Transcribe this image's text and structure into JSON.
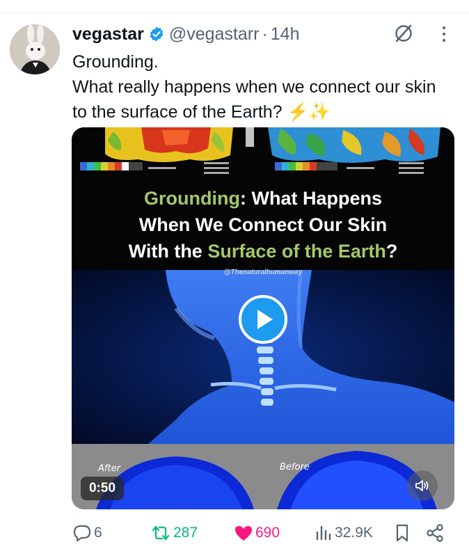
{
  "tweet": {
    "display_name": "vegastar",
    "handle": "@vegastarr",
    "separator": "·",
    "time": "14h",
    "text_line1": "Grounding.",
    "text_line2": "What really happens when we connect our skin to the surface of the Earth?",
    "emoji_bolt": "⚡",
    "emoji_sparkles": "✨"
  },
  "media": {
    "caption_p1_green": "Grounding",
    "caption_p1_rest": ": What Happens",
    "caption_line2": "When We Connect Our Skin",
    "caption_p3_start": "With the ",
    "caption_p3_green": "Surface of the Earth",
    "caption_p3_end": "?",
    "watermark": "@Thenaturalhumanway",
    "after_label": "After",
    "before_label": "Before",
    "duration": "0:50"
  },
  "actions": {
    "replies": "6",
    "retweets": "287",
    "likes": "690",
    "views": "32.9K"
  },
  "colors": {
    "accent_blue": "#1d9bf0",
    "retweet_green": "#00ba7c",
    "like_pink": "#f91880",
    "muted_text": "#536471",
    "caption_green": "#a5c86a"
  },
  "icons": [
    "verified-badge-icon",
    "grok-icon",
    "more-icon",
    "play-icon",
    "volume-icon",
    "reply-icon",
    "retweet-icon",
    "heart-icon",
    "views-icon",
    "bookmark-icon",
    "share-icon"
  ]
}
